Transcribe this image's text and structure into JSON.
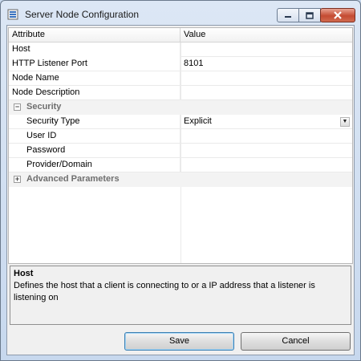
{
  "window": {
    "title": "Server Node Configuration"
  },
  "grid": {
    "columns": {
      "attribute": "Attribute",
      "value": "Value"
    },
    "rows": {
      "host": {
        "label": "Host",
        "value": ""
      },
      "http_port": {
        "label": "HTTP Listener Port",
        "value": "8101"
      },
      "node_name": {
        "label": "Node Name",
        "value": ""
      },
      "node_desc": {
        "label": "Node Description",
        "value": ""
      }
    },
    "security": {
      "label": "Security",
      "expander": "−",
      "security_type": {
        "label": "Security Type",
        "value": "Explicit"
      },
      "user_id": {
        "label": "User ID",
        "value": ""
      },
      "password": {
        "label": "Password",
        "value": ""
      },
      "provider": {
        "label": "Provider/Domain",
        "value": ""
      }
    },
    "advanced": {
      "label": "Advanced Parameters",
      "expander": "+"
    }
  },
  "help": {
    "title": "Host",
    "text": "Defines the host that a client is connecting to or a IP address that a listener is listening on"
  },
  "buttons": {
    "save": "Save",
    "cancel": "Cancel"
  },
  "colors": {
    "accent": "#3c7fb1",
    "close_button": "#c44b32"
  },
  "icons": {
    "app": "server-node-icon",
    "dropdown": "chevron-down-icon"
  }
}
